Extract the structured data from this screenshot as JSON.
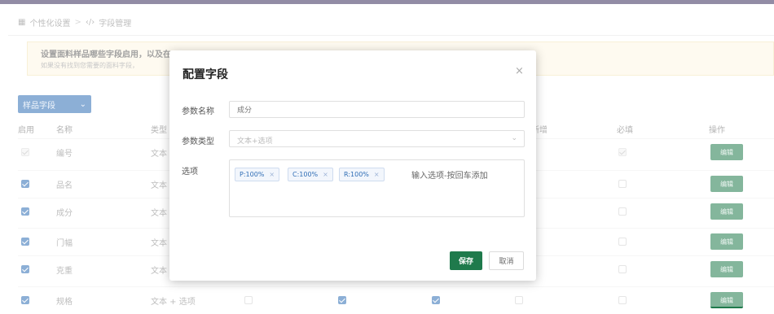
{
  "breadcrumb": {
    "icon": "grid-icon",
    "item1": "个性化设置",
    "separator": ">",
    "icon2": "code-icon",
    "item2": "字段管理"
  },
  "alert": {
    "title": "设置面料样品哪些字段启用，以及在",
    "subtitle": "如果没有找到您需要的面料字段，"
  },
  "toolbar": {
    "dropdown_label": "样品字段"
  },
  "table": {
    "headers": {
      "enable": "启用",
      "name": "名称",
      "type": "类型",
      "quick_add": "新增",
      "required": "必填",
      "actions": "操作"
    },
    "edit_label": "编辑",
    "rows": [
      {
        "enabled": "disabled",
        "name": "编号",
        "type": "文本"
      },
      {
        "enabled": "on",
        "name": "品名",
        "type": "文本"
      },
      {
        "enabled": "on",
        "name": "成分",
        "type": "文本"
      },
      {
        "enabled": "on",
        "name": "门幅",
        "type": "文本"
      },
      {
        "enabled": "on",
        "name": "克重",
        "type": "文本"
      },
      {
        "enabled": "on",
        "name": "规格",
        "type": "文本 + 选项"
      }
    ]
  },
  "modal": {
    "title": "配置字段",
    "close": "×",
    "param_name_label": "参数名称",
    "param_name_placeholder": "成分",
    "param_type_label": "参数类型",
    "param_type_value": "文本+选项",
    "options_label": "选项",
    "tags": [
      "P:100%",
      "C:100%",
      "R:100%"
    ],
    "tag_remove": "×",
    "options_placeholder": "输入选项-按回车添加",
    "save_label": "保存",
    "cancel_label": "取消"
  },
  "colors": {
    "primary": "#2f6db5",
    "success": "#1f7a4c",
    "alert_bg": "#fdf6e3"
  }
}
